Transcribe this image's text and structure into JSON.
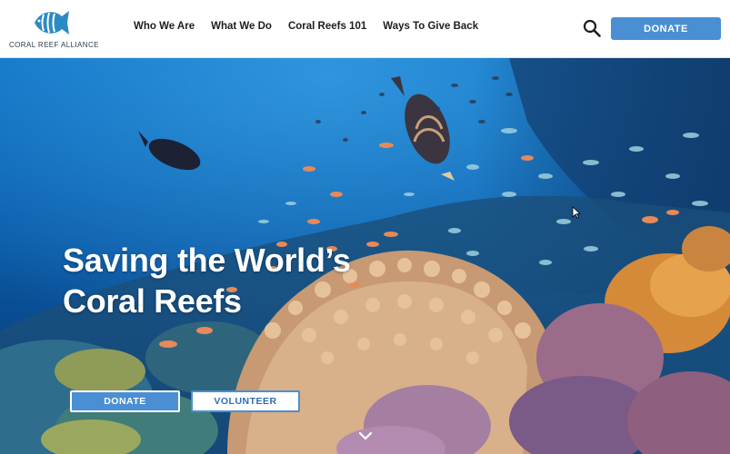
{
  "brand": {
    "logo_text": "CORAL REEF ALLIANCE"
  },
  "nav": {
    "items": [
      {
        "label": "Who We Are"
      },
      {
        "label": "What We Do"
      },
      {
        "label": "Coral Reefs 101"
      },
      {
        "label": "Ways To Give Back"
      }
    ]
  },
  "header": {
    "search_icon": "search-icon",
    "donate_label": "DONATE"
  },
  "hero": {
    "title": "Saving the World’s Coral Reefs",
    "donate_label": "DONATE",
    "volunteer_label": "VOLUNTEER",
    "scroll_icon": "chevron-down-icon"
  },
  "colors": {
    "accent": "#4a8fd4",
    "logo": "#2a8bc4",
    "text_dark": "#1d1d1d",
    "ocean": "#0b5aa8"
  }
}
